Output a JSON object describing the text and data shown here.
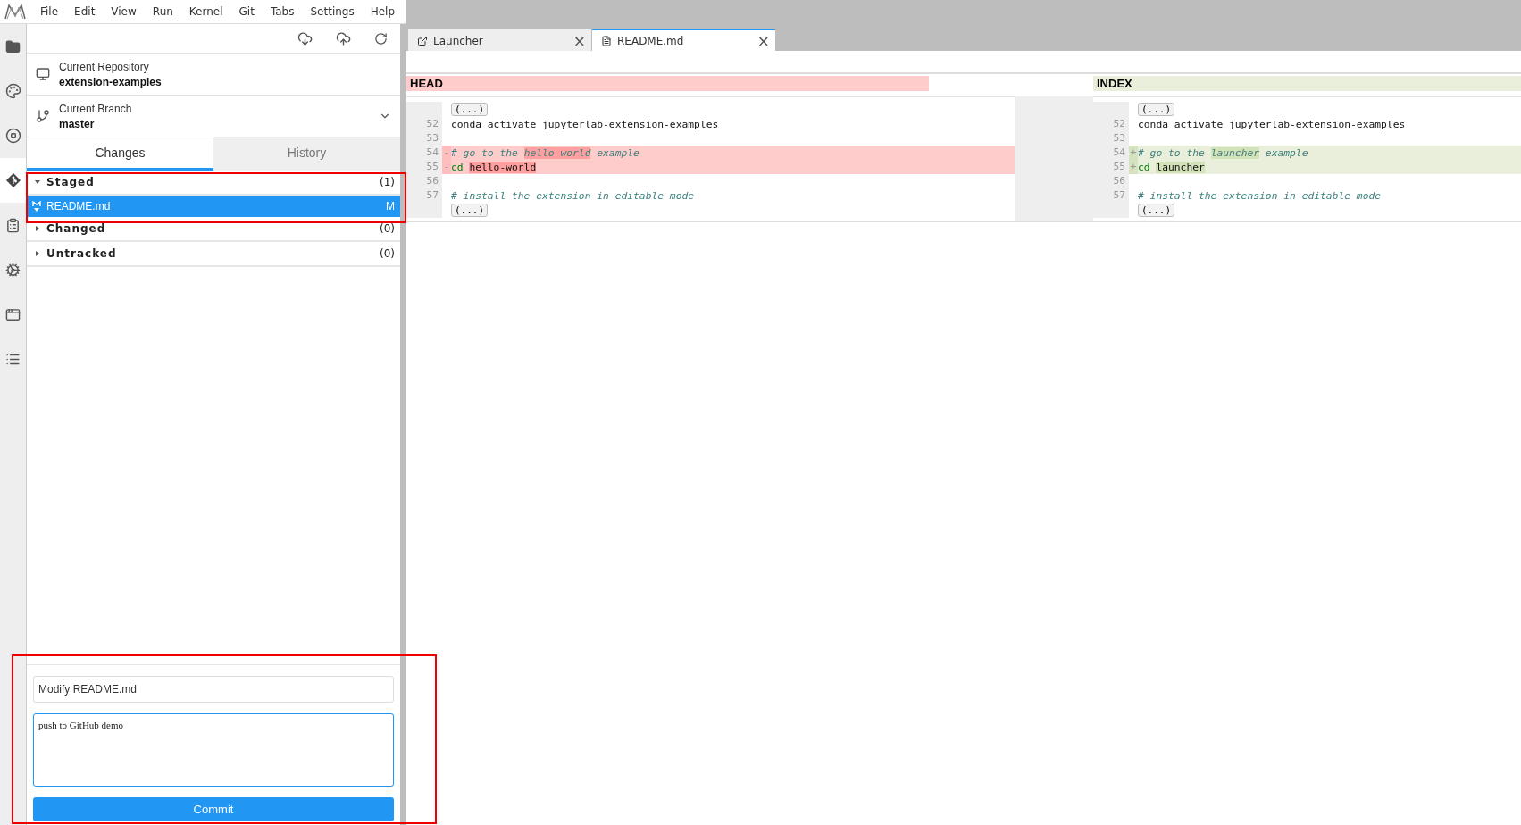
{
  "menu": [
    "File",
    "Edit",
    "View",
    "Run",
    "Kernel",
    "Git",
    "Tabs",
    "Settings",
    "Help"
  ],
  "activity_bar": [
    {
      "kind": "folder",
      "selected": false
    },
    {
      "kind": "running",
      "selected": false
    },
    {
      "kind": "stop",
      "selected": false
    },
    {
      "kind": "git",
      "selected": true
    },
    {
      "kind": "commands",
      "selected": false
    },
    {
      "kind": "extensions",
      "selected": false
    },
    {
      "kind": "tabs",
      "selected": false
    },
    {
      "kind": "toc",
      "selected": false
    }
  ],
  "git_panel": {
    "repository": {
      "label": "Current Repository",
      "value": "extension-examples"
    },
    "branch": {
      "label": "Current Branch",
      "value": "master"
    },
    "tabs": [
      {
        "label": "Changes",
        "selected": true
      },
      {
        "label": "History",
        "selected": false
      }
    ],
    "sections": [
      {
        "title": "Staged",
        "count": "(1)",
        "expanded": true,
        "files": [
          {
            "name": "README.md",
            "status": "M",
            "selected": true
          }
        ]
      },
      {
        "title": "Changed",
        "count": "(0)",
        "expanded": false
      },
      {
        "title": "Untracked",
        "count": "(0)",
        "expanded": false
      }
    ],
    "commit": {
      "summary": "Modify README.md",
      "description": "push to GitHub demo",
      "button": "Commit"
    }
  },
  "editor_tabs": [
    {
      "label": "Launcher",
      "kind": "launcher",
      "selected": false,
      "close": "×"
    },
    {
      "label": "README.md",
      "kind": "file",
      "selected": true,
      "close": "×"
    }
  ],
  "diff": [
    {
      "title": "HEAD",
      "lines": [
        {
          "kind": "fold",
          "text": "(...)"
        },
        {
          "kind": "line",
          "number": "52",
          "change": false,
          "parts": [
            {
              "text": "conda activate jupyterlab-extension-examples",
              "kind": "plain",
              "highlight": false
            }
          ]
        },
        {
          "kind": "line",
          "number": "53",
          "change": false
        },
        {
          "kind": "line",
          "number": "54",
          "change": true,
          "marker": "-",
          "parts": [
            {
              "text": "# go to the ",
              "kind": "comment",
              "highlight": false
            },
            {
              "text": "hello world",
              "kind": "comment",
              "highlight": true
            },
            {
              "text": " example",
              "kind": "comment",
              "highlight": false
            }
          ]
        },
        {
          "kind": "line",
          "number": "55",
          "change": true,
          "marker": "-",
          "parts": [
            {
              "text": "cd ",
              "kind": "keyword",
              "highlight": false
            },
            {
              "text": "hello-world",
              "kind": "plain",
              "highlight": true
            }
          ]
        },
        {
          "kind": "line",
          "number": "56",
          "change": false
        },
        {
          "kind": "line",
          "number": "57",
          "change": false,
          "parts": [
            {
              "text": "# install the extension in editable mode",
              "kind": "comment",
              "highlight": false
            }
          ]
        },
        {
          "kind": "fold",
          "text": "(...)"
        }
      ]
    },
    {
      "title": "INDEX",
      "lines": [
        {
          "kind": "fold",
          "text": "(...)"
        },
        {
          "kind": "line",
          "number": "52",
          "change": false,
          "parts": [
            {
              "text": "conda activate jupyterlab-extension-examples",
              "kind": "plain",
              "highlight": false
            }
          ]
        },
        {
          "kind": "line",
          "number": "53",
          "change": false
        },
        {
          "kind": "line",
          "number": "54",
          "change": true,
          "marker": "+",
          "parts": [
            {
              "text": "# go to the ",
              "kind": "comment",
              "highlight": false
            },
            {
              "text": "launcher",
              "kind": "comment",
              "highlight": true
            },
            {
              "text": " example",
              "kind": "comment",
              "highlight": false
            }
          ]
        },
        {
          "kind": "line",
          "number": "55",
          "change": true,
          "marker": "+",
          "parts": [
            {
              "text": "cd ",
              "kind": "keyword",
              "highlight": false
            },
            {
              "text": "launcher",
              "kind": "plain",
              "highlight": true
            }
          ]
        },
        {
          "kind": "line",
          "number": "56",
          "change": false
        },
        {
          "kind": "line",
          "number": "57",
          "change": false,
          "parts": [
            {
              "text": "# install the extension in editable mode",
              "kind": "comment",
              "highlight": false
            }
          ]
        },
        {
          "kind": "fold",
          "text": "(...)"
        }
      ]
    }
  ]
}
